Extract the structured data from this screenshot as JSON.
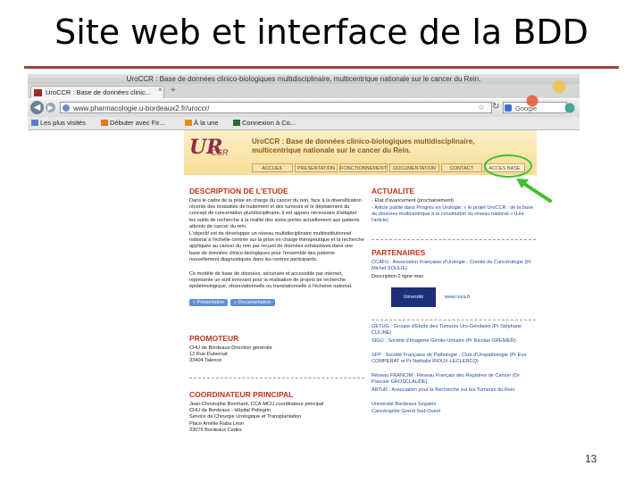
{
  "slide": {
    "title": "Site web et interface de la BDD",
    "page_number": "13"
  },
  "browser": {
    "window_title": "UroCCR : Base de données clinico-biologiques multidisciplinaire, multicentrique nationale sur le cancer du Rein.",
    "tab_label": "UroCCR : Base de données clinic...",
    "new_tab": "+",
    "close_tab": "×",
    "back": "◀",
    "forward": "▶",
    "url": "www.pharmacologie.u-bordeaux2.fr/uroccr/",
    "search_placeholder": "Google",
    "bookmarks": [
      "Les plus visités",
      "Débuter avec Fir...",
      "À la une",
      "Connexion à Co..."
    ]
  },
  "site": {
    "logo": "UR",
    "logo_sub": "CCR",
    "title": "UroCCR : Base de données clinico-biologiques multidisciplinaire, multicentrique nationale sur le cancer du Rein.",
    "menu": [
      "ACCUEIL",
      "PRESENTATION",
      "FONCTIONNEMENT",
      "DOCUMENTATION",
      "CONTACT",
      "ACCES BASE"
    ],
    "left": {
      "description_title": "DESCRIPTION DE L'ETUDE",
      "description_text_1": "Dans le cadre de la prise en charge du cancer du rein, face à la diversification récente des modalités de traitement et des tumeurs et le déploiement du concept de concertation pluridisciplinaire, il est apparu nécessaire d'adapter les outils de recherche à la réalité des soins portés actuellement aux patients atteints de cancer du rein.",
      "description_text_2": "L'objectif est de développer un réseau multidisciplinaire multiinstitutionnel national à l'échelle centrée sur la prise en charge thérapeutique et la recherche appliquée au cancer du rein par recueil de données exhaustives dans une base de données clinico-biologiques pour l'ensemble des patients nouvellement diagnostiqués dans les centres participants.",
      "description_text_3": "Ce modèle de base de données, sécurisée et accessible par internet, représente un outil innovant pour la réalisation de projets de recherche épidémiologique, observationnelle ou translationnelle à l'échelon national.",
      "btn_presentation": "» Présentation",
      "btn_documentation": "» Documentation",
      "promoteur_title": "PROMOTEUR",
      "promoteur_text": "CHU de Bordeaux-Direction générale\n12 Rue Dubernat\n33404 Talence",
      "coordinateur_title": "COORDINATEUR PRINCIPAL",
      "coordinateur_text": "Jean-Christophe Bernhard, CCA-MCU coordinateur principal\nCHU de Bordeaux - Hôpital Pellegrin\nService de Chirurgie Urologique et Transplantation\nPlace Amélie Raba Léon\n33076 Bordeaux Cedex"
    },
    "right": {
      "actualite_title": "ACTUALITE",
      "actualite_text_1": "- Etat d'avancement (prochainement)",
      "actualite_text_2": "- Article publié dans Progrès en Urologie: « le projet UroCCR : de la base de données multicentrique à la constitution du réseau national » (Lire l'article)",
      "partenaires_title": "PARTENAIRES",
      "afu": "CCAFU : Association Française d'Urologie - Comité de Cancérologie (Pr Michel SOULIE)",
      "afu_desc": "Description 2 ligne max",
      "univ_logo": "Université",
      "univ_link": "www.inca.fr",
      "partners_1": "GETUG : Groupe d'Étude des Tumeurs Uro-Génitales (Pr Stéphane CULINE)",
      "partners_2": "SIGU : Société d'Imagerie Génito-Urinaire (Pr Nicolas GRENIER)",
      "partners_3": "SFP : Société Française de Pathologie - Club d'Uropathologie (Pr Eva COMPERAT et Pr Nathalie RIOUX-LECLERCQ)",
      "partners_4": "Réseau FRANCIM : Réseau Français des Registres de Cancer (Dr Pascale GROSCLAUDE)",
      "partners_5": "ARTuR : Association pour la Recherche sur les Tumeurs du Rein",
      "partners_6": "Université Bordeaux Segalen",
      "partners_7": "Cancéropôle Grand Sud-Ouest"
    }
  }
}
